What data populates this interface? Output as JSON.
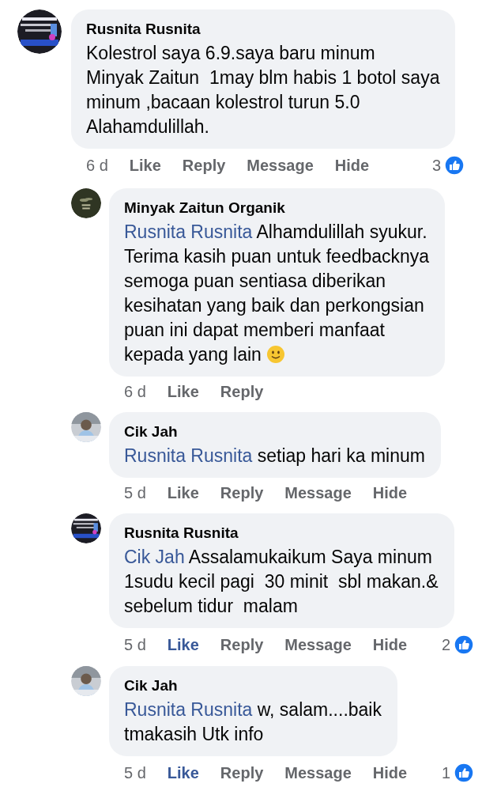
{
  "comments": [
    {
      "avatar": {
        "kind": "banner"
      },
      "author": "Rusnita Rusnita",
      "text": "Kolestrol saya 6.9.saya baru minum\nMinyak Zaitun  1may blm habis 1 botol saya\nminum ,bacaan kolestrol turun 5.0\nAlahamdulillah.",
      "time": "6 d",
      "actions": [
        {
          "label": "Like",
          "selected": false
        },
        {
          "label": "Reply"
        },
        {
          "label": "Message"
        },
        {
          "label": "Hide"
        }
      ],
      "reactions": "3",
      "children": [
        {
          "avatar": {
            "kind": "logo"
          },
          "author": "Minyak Zaitun Organik",
          "mention": "Rusnita Rusnita",
          "text": "Alhamdulillah syukur.\nTerima kasih puan untuk feedbacknya\nsemoga puan sentiasa diberikan\nkesihatan yang baik dan perkongsian\npuan ini dapat memberi manfaat\nkepada yang lain",
          "emoji": {
            "kind": "smile"
          },
          "time": "6 d",
          "actions": [
            {
              "label": "Like",
              "selected": false
            },
            {
              "label": "Reply"
            }
          ]
        },
        {
          "avatar": {
            "kind": "person"
          },
          "author": "Cik Jah",
          "mention": "Rusnita Rusnita",
          "text": "setiap hari ka minum",
          "time": "5 d",
          "actions": [
            {
              "label": "Like",
              "selected": false
            },
            {
              "label": "Reply"
            },
            {
              "label": "Message"
            },
            {
              "label": "Hide"
            }
          ]
        },
        {
          "avatar": {
            "kind": "banner"
          },
          "author": "Rusnita Rusnita",
          "mention": "Cik Jah",
          "text": "Assalamukaikum Saya minum\n1sudu kecil pagi  30 minit  sbl makan.&\nsebelum tidur  malam",
          "time": "5 d",
          "actions": [
            {
              "label": "Like",
              "selected": true
            },
            {
              "label": "Reply"
            },
            {
              "label": "Message"
            },
            {
              "label": "Hide"
            }
          ],
          "reactions": "2"
        },
        {
          "avatar": {
            "kind": "person"
          },
          "author": "Cik Jah",
          "mention": "Rusnita Rusnita",
          "text": "w, salam....baik\ntmakasih Utk info",
          "time": "5 d",
          "actions": [
            {
              "label": "Like",
              "selected": true
            },
            {
              "label": "Reply"
            },
            {
              "label": "Message"
            },
            {
              "label": "Hide"
            }
          ],
          "reactions": "1"
        }
      ]
    }
  ]
}
